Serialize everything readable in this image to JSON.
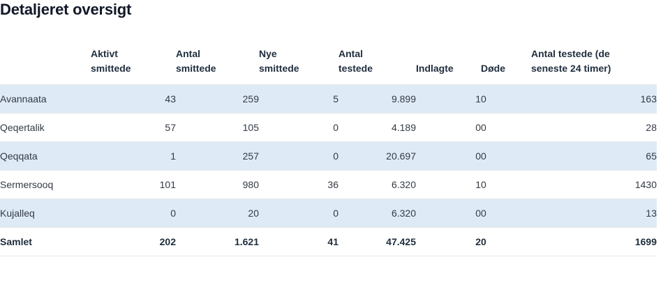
{
  "page": {
    "title": "Detaljeret oversigt"
  },
  "table": {
    "headers": {
      "region": "",
      "aktivt_smittede": "Aktivt smittede",
      "antal_smittede": "Antal smittede",
      "nye_smittede": "Nye smittede",
      "antal_testede": "Antal testede",
      "indlagte": "Indlagte",
      "dode": "Døde",
      "antal_testede_24": "Antal testede (de seneste 24 timer)"
    },
    "header_lines": {
      "aktivt_smittede": [
        "Aktivt",
        "smittede"
      ],
      "antal_smittede": [
        "Antal",
        "smittede"
      ],
      "nye_smittede": [
        "Nye",
        "smittede"
      ],
      "antal_testede": [
        "Antal",
        "testede"
      ],
      "antal_testede_24": [
        "Antal testede (de",
        "seneste 24 timer)"
      ]
    },
    "rows": [
      {
        "region": "Avannaata",
        "aktivt_smittede": "43",
        "antal_smittede": "259",
        "nye_smittede": "5",
        "antal_testede": "9.899",
        "indlagte": "1",
        "dode": "0",
        "antal_testede_24": "163"
      },
      {
        "region": "Qeqertalik",
        "aktivt_smittede": "57",
        "antal_smittede": "105",
        "nye_smittede": "0",
        "antal_testede": "4.189",
        "indlagte": "0",
        "dode": "0",
        "antal_testede_24": "28"
      },
      {
        "region": "Qeqqata",
        "aktivt_smittede": "1",
        "antal_smittede": "257",
        "nye_smittede": "0",
        "antal_testede": "20.697",
        "indlagte": "0",
        "dode": "0",
        "antal_testede_24": "65"
      },
      {
        "region": "Sermersooq",
        "aktivt_smittede": "101",
        "antal_smittede": "980",
        "nye_smittede": "36",
        "antal_testede": "6.320",
        "indlagte": "1",
        "dode": "0",
        "antal_testede_24": "1430"
      },
      {
        "region": "Kujalleq",
        "aktivt_smittede": "0",
        "antal_smittede": "20",
        "nye_smittede": "0",
        "antal_testede": "6.320",
        "indlagte": "0",
        "dode": "0",
        "antal_testede_24": "13"
      }
    ],
    "total": {
      "region": "Samlet",
      "aktivt_smittede": "202",
      "antal_smittede": "1.621",
      "nye_smittede": "41",
      "antal_testede": "47.425",
      "indlagte": "2",
      "dode": "0",
      "antal_testede_24": "1699"
    }
  },
  "colors": {
    "row_shade": "#deebf7",
    "divider": "#e5e7eb",
    "text": "#1f2d3d"
  }
}
